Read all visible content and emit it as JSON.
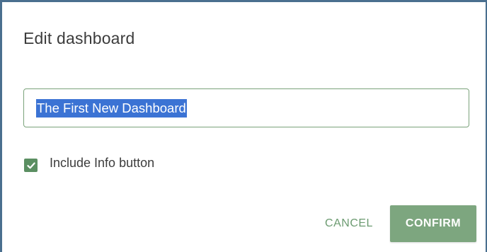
{
  "dialog": {
    "title": "Edit dashboard",
    "name_input": {
      "value": "The First New Dashboard",
      "selected": true
    },
    "include_info": {
      "label": "Include Info button",
      "checked": true
    },
    "buttons": {
      "cancel_label": "CANCEL",
      "confirm_label": "CONFIRM"
    }
  },
  "colors": {
    "accent_green": "#7da67f",
    "checkbox_green": "#5b8f62",
    "cancel_text": "#6c9b71",
    "input_border": "#7aa27a",
    "selection_blue": "#3b73d4",
    "frame_border": "#4a6f8f"
  },
  "icons": {
    "checkbox": "check-icon"
  }
}
